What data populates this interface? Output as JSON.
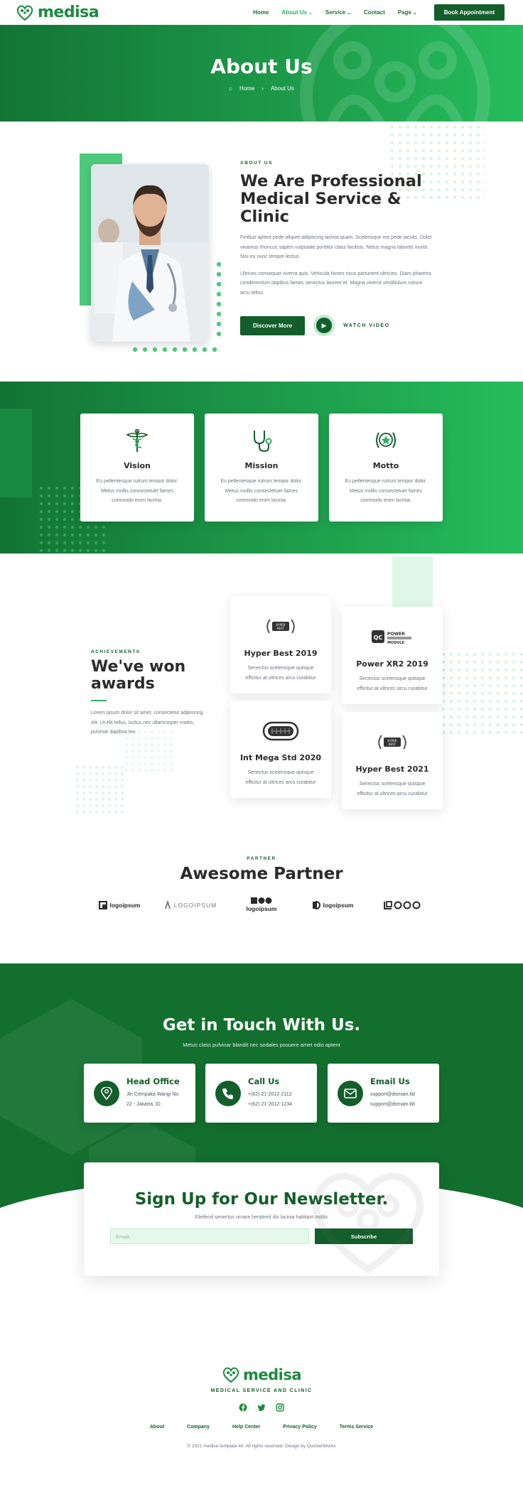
{
  "nav": {
    "brand": "medisa",
    "links": [
      "Home",
      "About Us",
      "Service",
      "Contact",
      "Page"
    ],
    "cta": "Book Appointment"
  },
  "hero": {
    "title": "About Us",
    "crumb_home": "Home",
    "crumb_current": "About Us"
  },
  "about": {
    "kicker": "ABOUT US",
    "title": "We Are Professional Medical Service & Clinic",
    "para1": "Finibus aptent pede aliquet adipiscing lacinia quam. Scelerisque est pede iaculis. Dolor vivamus rhoncus sapien vulputate porttitor class facilisis. Netus magna lobortis morbi. Nisi eu nunc tempor lectus.",
    "para2": "Ultrices consequat viverra quis. Vehicula fames risus parturient ultricies. Diam pharetra condimentum dapibus fames senectus laoreet et. Magna viverra vestibulum rutrum arcu tellus.",
    "cta": "Discover More",
    "watch": "WATCH VIDEO"
  },
  "values": [
    {
      "title": "Vision",
      "text": "Eu pellentesque rutrum tempor dolor. Metus mollis consectetuer fames commodo enim lacinia.",
      "icon": "caduceus-icon"
    },
    {
      "title": "Mission",
      "text": "Eu pellentesque rutrum tempor dolor. Metus mollis consectetuer fames commodo enim lacinia.",
      "icon": "stethoscope-icon"
    },
    {
      "title": "Motto",
      "text": "Eu pellentesque rutrum tempor dolor. Metus mollis consectetuer fames commodo enim lacinia.",
      "icon": "laurel-star-icon"
    }
  ],
  "awards": {
    "kicker": "ACHIEVEMENTS",
    "title": "We've won awards",
    "text": "Lorem ipsum dolor sit amet, consectetur adipiscing elit. Ut elit tellus, luctus nec ullamcorper mattis, pulvinar dapibus leo.",
    "items": [
      {
        "title": "Hyper Best 2019",
        "text": "Senectus scelerisque quisque efficitur at ultrices arcu curabitur",
        "badge": "HYPER BEST"
      },
      {
        "title": "Power XR2 2019",
        "text": "Senectus scelerisque quisque efficitur at ultrices arcu curabitur",
        "badge": "POWER MODULE"
      },
      {
        "title": "Int Mega Std 2020",
        "text": "Senectus scelerisque quisque efficitur at ultrices arcu curabitur",
        "badge": ""
      },
      {
        "title": "Hyper Best 2021",
        "text": "Senectus scelerisque quisque efficitur at ultrices arcu curabitur",
        "badge": "HYPER BEST"
      }
    ]
  },
  "partner": {
    "kicker": "PARTNER",
    "title": "Awesome Partner",
    "logos": [
      "logoipsum",
      "LOGOIPSUM",
      "logoipsum",
      "logoipsum",
      "OOO"
    ]
  },
  "contact": {
    "title": "Get in Touch With Us.",
    "subtitle": "Metus class pulvinar blandit nec sodales posuere amet odio aptent",
    "cards": [
      {
        "title": "Head Office",
        "line1": "Jln Cempaka Wangi No",
        "line2": "22 - Jakarta, ID",
        "icon": "location-pin-icon"
      },
      {
        "title": "Call Us",
        "line1": "+(62) 21-2012-2112",
        "line2": "+(62) 21-2012-1234",
        "icon": "phone-icon"
      },
      {
        "title": "Email Us",
        "line1": "support@domain.tld",
        "line2": "support@domain.tld",
        "icon": "envelope-icon"
      }
    ]
  },
  "newsletter": {
    "title": "Sign Up for Our Newsletter.",
    "subtitle": "Eleifend senectus ornare hendrerit dis lacinia habitant mollis",
    "placeholder": "Email",
    "button": "Subscribe"
  },
  "footer": {
    "brand": "medisa",
    "tagline": "MEDICAL SERVICE AND CLINIC",
    "links": [
      "About",
      "Company",
      "Help Center",
      "Privacy Policy",
      "Terms Service"
    ],
    "copyright": "© 2021 medisa template kit. All rights reserved. Design by QuickerWorks"
  },
  "colors": {
    "primary_dark": "#135e2b",
    "primary": "#1e9c4a",
    "accent": "#25bd5d",
    "mint": "#dff7e7"
  }
}
